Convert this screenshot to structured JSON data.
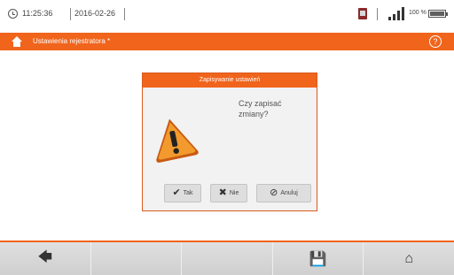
{
  "status_bar": {
    "time": "11:25:36",
    "date": "2016-02-26",
    "battery_text": "100 %",
    "icons": [
      "clock-icon",
      "file-icon",
      "signal-icon",
      "battery-icon"
    ]
  },
  "title_bar": {
    "title": "Ustawienia rejestratora *",
    "icons": [
      "home-icon",
      "help-icon"
    ],
    "help_glyph": "?"
  },
  "dialog": {
    "header": "Zapisywanie ustawień",
    "message_line1": "Czy zapisać",
    "message_line2": "zmiany?",
    "buttons": [
      {
        "label": "Tak",
        "icon": "check-icon",
        "glyph": "✔"
      },
      {
        "label": "Nie",
        "icon": "x-icon",
        "glyph": "✖"
      },
      {
        "label": "Anuluj",
        "icon": "cancel-icon",
        "glyph": "⊘"
      }
    ]
  },
  "toolbar": {
    "buttons": [
      {
        "name": "back",
        "icon": "back-arrow-icon",
        "glyph": "🡄"
      },
      {
        "name": "empty-1",
        "icon": "",
        "glyph": ""
      },
      {
        "name": "empty-2",
        "icon": "",
        "glyph": ""
      },
      {
        "name": "save",
        "icon": "save-icon",
        "glyph": "💾"
      },
      {
        "name": "home",
        "icon": "home-icon",
        "glyph": "⌂"
      }
    ]
  },
  "colors": {
    "accent": "#f0641c",
    "dialog_bg": "#f2f2f2",
    "toolbar_bg": "#d6d6d6"
  }
}
